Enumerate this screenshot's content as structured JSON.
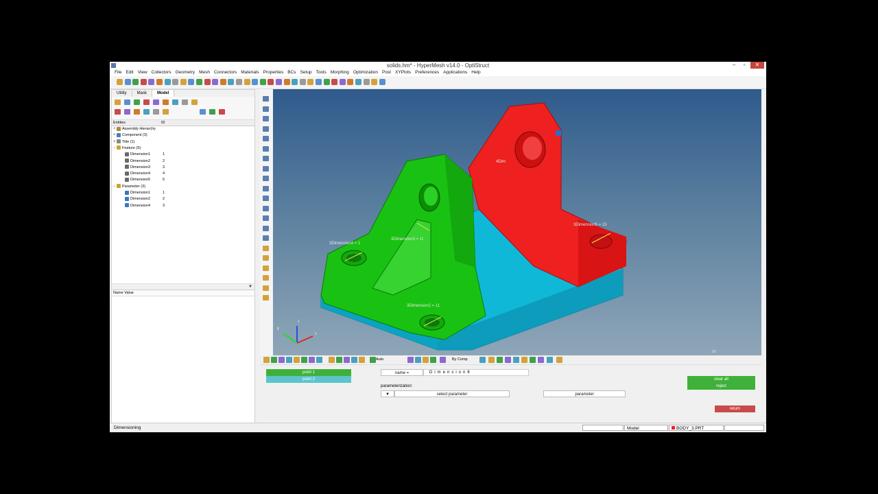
{
  "window": {
    "title": "solids.hm* - HyperMesh v14.0 - OptiStruct",
    "min": "–",
    "max": "▫",
    "close": "✕"
  },
  "menu": [
    "File",
    "Edit",
    "View",
    "Collectors",
    "Geometry",
    "Mesh",
    "Connectors",
    "Materials",
    "Properties",
    "BCs",
    "Setup",
    "Tools",
    "Morphing",
    "Optimization",
    "Post",
    "XYPlots",
    "Preferences",
    "Applications",
    "Help"
  ],
  "tabs": [
    "Utility",
    "Mask",
    "Model"
  ],
  "tree": {
    "header_entities": "Entities",
    "header_id": "ID",
    "nodes": [
      {
        "label": "Assembly Hierarchy",
        "id": "",
        "level": 0,
        "color": "#b08a3a",
        "pm": "+"
      },
      {
        "label": "Component (3)",
        "id": "",
        "level": 0,
        "color": "#4a7cc0",
        "pm": "+"
      },
      {
        "label": "Title (1)",
        "id": "",
        "level": 0,
        "color": "#888888",
        "pm": "+"
      },
      {
        "label": "Feature (5)",
        "id": "",
        "level": 0,
        "color": "#c9a23a",
        "pm": "−"
      },
      {
        "label": "Dimension1",
        "id": "1",
        "level": 1,
        "color": "#6a6a6a",
        "pm": ""
      },
      {
        "label": "Dimension2",
        "id": "2",
        "level": 1,
        "color": "#6a6a6a",
        "pm": ""
      },
      {
        "label": "Dimension3",
        "id": "3",
        "level": 1,
        "color": "#6a6a6a",
        "pm": ""
      },
      {
        "label": "Dimension4",
        "id": "4",
        "level": 1,
        "color": "#6a6a6a",
        "pm": ""
      },
      {
        "label": "Dimension5",
        "id": "5",
        "level": 1,
        "color": "#6a6a6a",
        "pm": ""
      },
      {
        "label": "Parameter (3)",
        "id": "",
        "level": 0,
        "color": "#c9a23a",
        "pm": "−"
      },
      {
        "label": "Dimension1",
        "id": "1",
        "level": 1,
        "color": "#3a78c0",
        "pm": ""
      },
      {
        "label": "Dimension2",
        "id": "2",
        "level": 1,
        "color": "#3a78c0",
        "pm": ""
      },
      {
        "label": "Dimension4",
        "id": "3",
        "level": 1,
        "color": "#3a78c0",
        "pm": ""
      }
    ]
  },
  "name_value_header": "Name Value",
  "viewport": {
    "annotations": [
      "4Dim",
      "3Dimension5 = 15",
      "3Dimension3 = 1t",
      "3Dimension4 = 1",
      "3Dimension2 = 11"
    ],
    "axes": {
      "x": "x",
      "y": "y",
      "z": "z"
    },
    "scale": "20"
  },
  "bottom_toolbar": {
    "auto_label": "Auto",
    "bycomp_label": "By Comp"
  },
  "panel": {
    "point1": "point 1",
    "point2": "point 2",
    "name_label": "name =",
    "name_value": "Dimension6",
    "parameterization_label": "parameterization:",
    "select_parameter": "select parameter",
    "parameter": "parameter",
    "clear_all": "clear all",
    "reject": "reject",
    "return": "return"
  },
  "status": {
    "mode": "Dimensioning",
    "model": "Model",
    "body": "BODY_3.PRT"
  },
  "colors": {
    "accent_green": "#3fb13a",
    "accent_teal": "#5cc4cc",
    "part_green": "#19c212",
    "part_red": "#ee2020",
    "part_cyan": "#10b8d8",
    "return_red": "#c84a4a"
  }
}
